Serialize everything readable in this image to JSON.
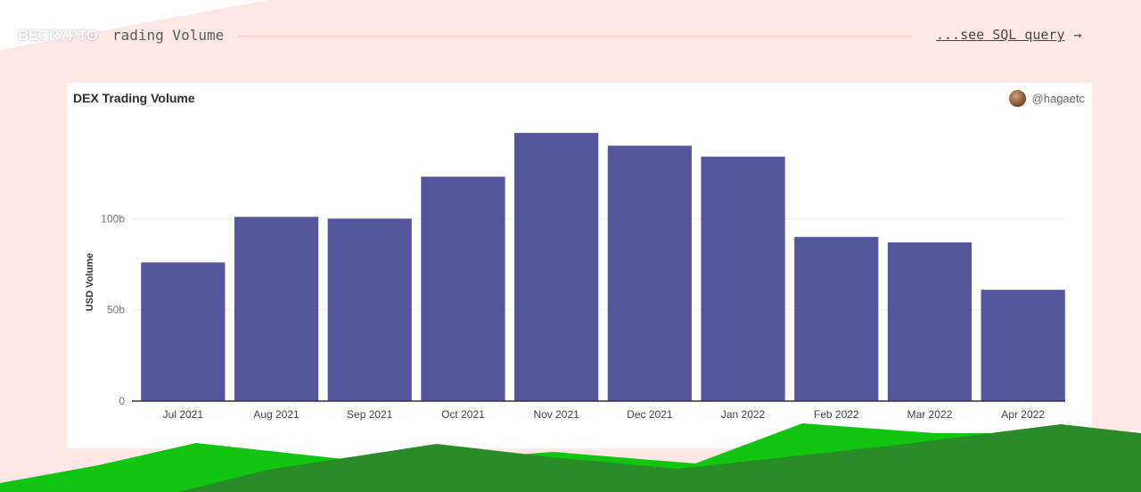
{
  "brand": {
    "name": "BECRYPTO"
  },
  "header": {
    "title": "rading Volume",
    "sql_link": "...see SQL query",
    "arrow": "→"
  },
  "card": {
    "author": "@hagaetc"
  },
  "colors": {
    "bar": "#55559c",
    "background": "#fde8e6",
    "hill_dark": "#2a8c29",
    "hill_light": "#11c511"
  },
  "chart_data": {
    "type": "bar",
    "title": "DEX Trading Volume",
    "xlabel": "",
    "ylabel": "USD Volume",
    "categories": [
      "Jul 2021",
      "Aug 2021",
      "Sep 2021",
      "Oct 2021",
      "Nov 2021",
      "Dec 2021",
      "Jan 2022",
      "Feb 2022",
      "Mar 2022",
      "Apr 2022"
    ],
    "values": [
      76,
      101,
      100,
      123,
      147,
      140,
      134,
      90,
      87,
      61
    ],
    "value_unit": "b",
    "y_ticks": [
      0,
      50,
      100
    ],
    "y_tick_labels": [
      "0",
      "50b",
      "100b"
    ],
    "ylim": [
      0,
      150
    ],
    "grid": true,
    "legend": "none"
  }
}
